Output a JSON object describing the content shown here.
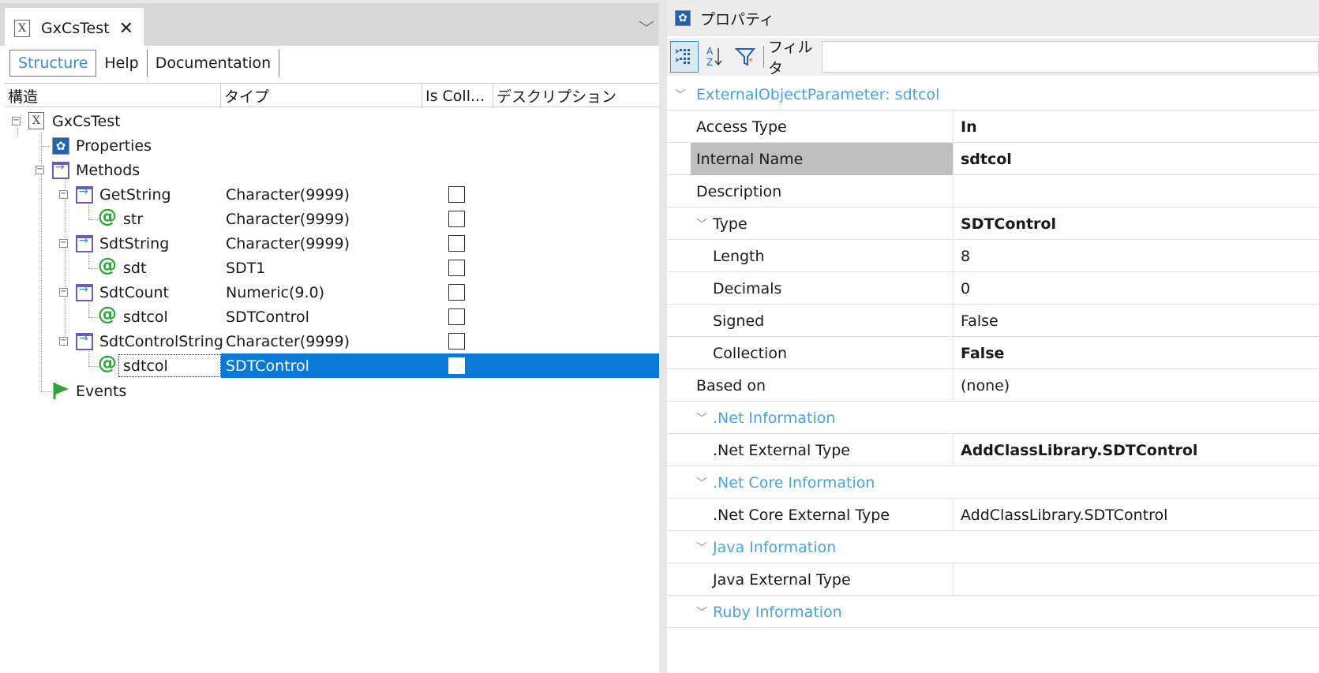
{
  "left": {
    "doc_tab": {
      "title": "GxCsTest",
      "close": "✕"
    },
    "tab_menu": "﹀",
    "subtabs": [
      "Structure",
      "Help",
      "Documentation"
    ],
    "columns": [
      "構造",
      "タイプ",
      "Is Coll...",
      "デスクリプション"
    ],
    "tree": [
      {
        "name": "GxCsTest",
        "type": "",
        "checkbox": false
      },
      {
        "name": "Properties",
        "type": "",
        "checkbox": false
      },
      {
        "name": "Methods",
        "type": "",
        "checkbox": false
      },
      {
        "name": "GetString",
        "type": "Character(9999)",
        "checkbox": true,
        "checked": false
      },
      {
        "name": "str",
        "type": "Character(9999)",
        "checkbox": true,
        "checked": false
      },
      {
        "name": "SdtString",
        "type": "Character(9999)",
        "checkbox": true,
        "checked": false
      },
      {
        "name": "sdt",
        "type": "SDT1",
        "checkbox": true,
        "checked": false
      },
      {
        "name": "SdtCount",
        "type": "Numeric(9.0)",
        "checkbox": true,
        "checked": false
      },
      {
        "name": "sdtcol",
        "type": "SDTControl",
        "checkbox": true,
        "checked": false
      },
      {
        "name": "SdtControlString",
        "type": "Character(9999)",
        "checkbox": true,
        "checked": false
      },
      {
        "name": "sdtcol",
        "type": "SDTControl",
        "checkbox": true,
        "checked": false,
        "selected": true
      },
      {
        "name": "Events",
        "type": "",
        "checkbox": false
      }
    ],
    "tree_glyphs": {
      "expanded": "−",
      "at": "@",
      "gear": "✿",
      "x_icon": "X"
    }
  },
  "right": {
    "header_title": "プロパティ",
    "toolbar": {
      "filter_label": "フィルタ",
      "az": "A↓Z"
    },
    "properties": [
      {
        "name": "ExternalObjectParameter: sdtcol",
        "value": "",
        "kind": "category"
      },
      {
        "name": "Access Type",
        "value": "In",
        "bold": true
      },
      {
        "name": "Internal Name",
        "value": "sdtcol",
        "bold": true,
        "highlight": true
      },
      {
        "name": "Description",
        "value": ""
      },
      {
        "name": "Type",
        "value": "SDTControl",
        "bold": true,
        "expandable": true
      },
      {
        "name": "Length",
        "value": "8",
        "sub": true
      },
      {
        "name": "Decimals",
        "value": "0",
        "sub": true
      },
      {
        "name": "Signed",
        "value": "False",
        "sub": true
      },
      {
        "name": "Collection",
        "value": "False",
        "bold": true,
        "sub": true
      },
      {
        "name": "Based on",
        "value": "(none)"
      },
      {
        "name": ".Net Information",
        "value": "",
        "kind": "subcategory"
      },
      {
        "name": ".Net External Type",
        "value": "AddClassLibrary.SDTControl",
        "bold": true,
        "sub": true
      },
      {
        "name": ".Net Core Information",
        "value": "",
        "kind": "subcategory"
      },
      {
        "name": ".Net Core External Type",
        "value": "AddClassLibrary.SDTControl",
        "sub": true
      },
      {
        "name": "Java Information",
        "value": "",
        "kind": "subcategory"
      },
      {
        "name": "Java External Type",
        "value": "",
        "sub": true
      },
      {
        "name": "Ruby Information",
        "value": "",
        "kind": "subcategory"
      }
    ],
    "chevron": "﹀"
  },
  "colors": {
    "accent": "#3a8ed8",
    "selection": "#0a78d7",
    "category_text": "#48a3e0",
    "method_icon": "#6d5bb5",
    "at_icon": "#2aa635"
  }
}
